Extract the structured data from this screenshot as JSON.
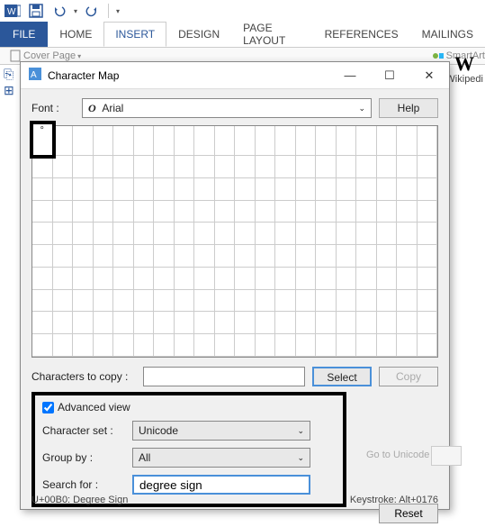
{
  "qat": {
    "undo_caret": "▾",
    "redo_caret": "▾"
  },
  "ribbon": {
    "file": "FILE",
    "tabs": [
      "HOME",
      "INSERT",
      "DESIGN",
      "PAGE LAYOUT",
      "REFERENCES",
      "MAILINGS"
    ],
    "active_index": 1,
    "strip": {
      "cover_page": "Cover Page",
      "smartart": "SmartArt"
    }
  },
  "side": {
    "wiki": "W",
    "wiki_label": "Wikipedi"
  },
  "dialog": {
    "title": "Character Map",
    "font_label": "Font :",
    "font_value": "Arial",
    "font_italic_o": "O",
    "help": "Help",
    "selected_char": "°",
    "copy_label": "Characters to copy :",
    "select_btn": "Select",
    "copy_btn": "Copy",
    "adv_check": "Advanced view",
    "charset_label": "Character set :",
    "charset_value": "Unicode",
    "groupby_label": "Group by :",
    "groupby_value": "All",
    "search_label": "Search for :",
    "search_value": "degree sign",
    "goto_label": "Go to Unicode :",
    "reset": "Reset",
    "status_left": "U+00B0: Degree Sign",
    "status_right": "Keystroke: Alt+0176"
  }
}
